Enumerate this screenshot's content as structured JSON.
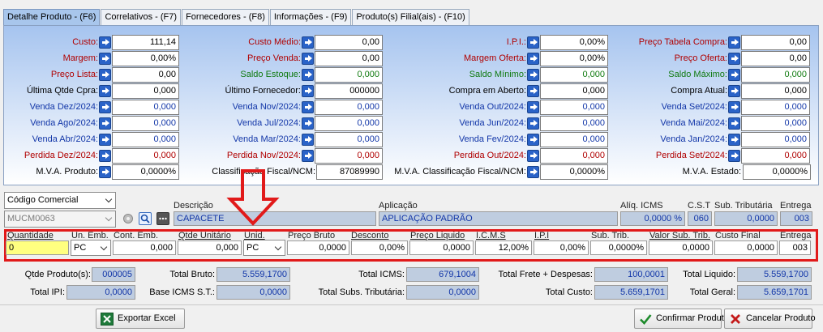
{
  "tabs": [
    {
      "label": "Detalhe Produto - (F6)",
      "active": true
    },
    {
      "label": "Correlativos - (F7)"
    },
    {
      "label": "Fornecedores - (F8)"
    },
    {
      "label": "Informações - (F9)"
    },
    {
      "label": "Produto(s) Filial(ais) - (F10)"
    }
  ],
  "grid": [
    [
      {
        "label": "Custo:",
        "value": "111,14",
        "lc": "red",
        "vc": ""
      },
      {
        "label": "Custo Médio:",
        "value": "0,00",
        "lc": "red",
        "vc": ""
      },
      {
        "label": "I.P.I.:",
        "value": "0,00%",
        "lc": "red",
        "vc": ""
      },
      {
        "label": "Preço Tabela Compra:",
        "value": "0,00",
        "lc": "red",
        "vc": ""
      }
    ],
    [
      {
        "label": "Margem:",
        "value": "0,00%",
        "lc": "red",
        "vc": ""
      },
      {
        "label": "Preço Venda:",
        "value": "0,00",
        "lc": "red",
        "vc": ""
      },
      {
        "label": "Margem Oferta:",
        "value": "0,00%",
        "lc": "red",
        "vc": ""
      },
      {
        "label": "Preço Oferta:",
        "value": "0,00",
        "lc": "red",
        "vc": ""
      }
    ],
    [
      {
        "label": "Preço Lista:",
        "value": "0,00",
        "lc": "red",
        "vc": ""
      },
      {
        "label": "Saldo Estoque:",
        "value": "0,000",
        "lc": "green",
        "vc": "green"
      },
      {
        "label": "Saldo Mínimo:",
        "value": "0,000",
        "lc": "green",
        "vc": "green"
      },
      {
        "label": "Saldo Máximo:",
        "value": "0,000",
        "lc": "green",
        "vc": "green"
      }
    ],
    [
      {
        "label": "Última Qtde Cpra:",
        "value": "0,000",
        "lc": "black",
        "vc": ""
      },
      {
        "label": "Último Fornecedor:",
        "value": "000000",
        "lc": "black",
        "vc": ""
      },
      {
        "label": "Compra em Aberto:",
        "value": "0,000",
        "lc": "black",
        "vc": ""
      },
      {
        "label": "Compra Atual:",
        "value": "0,000",
        "lc": "black",
        "vc": ""
      }
    ],
    [
      {
        "label": "Venda Dez/2024:",
        "value": "0,000",
        "lc": "blue",
        "vc": "blue"
      },
      {
        "label": "Venda Nov/2024:",
        "value": "0,000",
        "lc": "blue",
        "vc": "blue"
      },
      {
        "label": "Venda Out/2024:",
        "value": "0,000",
        "lc": "blue",
        "vc": "blue"
      },
      {
        "label": "Venda Set/2024:",
        "value": "0,000",
        "lc": "blue",
        "vc": "blue"
      }
    ],
    [
      {
        "label": "Venda Ago/2024:",
        "value": "0,000",
        "lc": "blue",
        "vc": "blue"
      },
      {
        "label": "Venda Jul/2024:",
        "value": "0,000",
        "lc": "blue",
        "vc": "blue"
      },
      {
        "label": "Venda Jun/2024:",
        "value": "0,000",
        "lc": "blue",
        "vc": "blue"
      },
      {
        "label": "Venda Mai/2024:",
        "value": "0,000",
        "lc": "blue",
        "vc": "blue"
      }
    ],
    [
      {
        "label": "Venda Abr/2024:",
        "value": "0,000",
        "lc": "blue",
        "vc": "blue"
      },
      {
        "label": "Venda Mar/2024:",
        "value": "0,000",
        "lc": "blue",
        "vc": "blue"
      },
      {
        "label": "Venda Fev/2024:",
        "value": "0,000",
        "lc": "blue",
        "vc": "blue"
      },
      {
        "label": "Venda Jan/2024:",
        "value": "0,000",
        "lc": "blue",
        "vc": "blue"
      }
    ],
    [
      {
        "label": "Perdida Dez/2024:",
        "value": "0,000",
        "lc": "red",
        "vc": "red"
      },
      {
        "label": "Perdida Nov/2024:",
        "value": "0,000",
        "lc": "red",
        "vc": "red"
      },
      {
        "label": "Perdida Out/2024:",
        "value": "0,000",
        "lc": "red",
        "vc": "red"
      },
      {
        "label": "Perdida Set/2024:",
        "value": "0,000",
        "lc": "red",
        "vc": "red"
      }
    ],
    [
      {
        "label": "M.V.A. Produto:",
        "value": "0,0000%",
        "lc": "black",
        "vc": ""
      },
      {
        "label": "Classificação Fiscal/NCM:",
        "value": "87089990",
        "lc": "black",
        "vc": ""
      },
      {
        "label": "M.V.A. Classificação Fiscal/NCM:",
        "value": "0,0000%",
        "lc": "black",
        "vc": ""
      },
      {
        "label": "M.V.A. Estado:",
        "value": "0,0000%",
        "lc": "black",
        "vc": ""
      }
    ]
  ],
  "product": {
    "code_type": "Código Comercial",
    "code": "MUCM0063",
    "headers": {
      "descricao": "Descrição",
      "aplicacao": "Aplicação",
      "aliq_icms": "Alíq. ICMS",
      "cst": "C.S.T",
      "sub_trib": "Sub. Tributária",
      "entrega": "Entrega"
    },
    "descricao": "CAPACETE",
    "aplicacao": "APLICAÇÃO PADRÃO",
    "aliq_icms": "0,0000 %",
    "cst": "060",
    "sub_trib": "0,0000",
    "entrega": "003"
  },
  "order": {
    "headers": {
      "quantidade": "Quantidade",
      "un_emb": "Un. Emb.",
      "cont_emb": "Cont. Emb.",
      "qtde_unitario": "Qtde Unitário",
      "unid": "Unid.",
      "preco_bruto": "Preço Bruto",
      "desconto": "Desconto",
      "preco_liquido": "Preço Liquido",
      "icms": "I.C.M.S",
      "ipi": "I.P.I",
      "sub_trib": "Sub. Trib.",
      "valor_sub_trib": "Valor Sub. Trib.",
      "custo_final": "Custo Final",
      "entrega": "Entrega"
    },
    "quantidade": "0",
    "un_emb": "PC",
    "cont_emb": "0,000",
    "qtde_unitario": "0,000",
    "unid": "PC",
    "preco_bruto": "0,0000",
    "desconto": "0,00%",
    "preco_liquido": "0,0000",
    "icms": "12,00%",
    "ipi": "0,00%",
    "sub_trib": "0,0000%",
    "valor_sub_trib": "0,0000",
    "custo_final": "0,0000",
    "entrega": "003"
  },
  "totals": {
    "qtde_produtos_label": "Qtde Produto(s):",
    "qtde_produtos": "000005",
    "total_bruto_label": "Total Bruto:",
    "total_bruto": "5.559,1700",
    "total_icms_label": "Total ICMS:",
    "total_icms": "679,1004",
    "total_frete_label": "Total Frete + Despesas:",
    "total_frete": "100,0001",
    "total_liquido_label": "Total Liquido:",
    "total_liquido": "5.559,1700",
    "total_ipi_label": "Total IPI:",
    "total_ipi": "0,0000",
    "base_icms_st_label": "Base ICMS S.T.:",
    "base_icms_st": "0,0000",
    "total_subs_label": "Total Subs. Tributária:",
    "total_subs": "0,0000",
    "total_custo_label": "Total Custo:",
    "total_custo": "5.659,1701",
    "total_geral_label": "Total Geral:",
    "total_geral": "5.659,1701"
  },
  "buttons": {
    "exportar": "Exportar Excel",
    "confirmar": "Confirmar Produto",
    "cancelar": "Cancelar Produto"
  },
  "colors": {
    "annotation": "#e11a1a",
    "panel_top": "#a6c4ef",
    "readonly_field": "#bfcde0"
  }
}
